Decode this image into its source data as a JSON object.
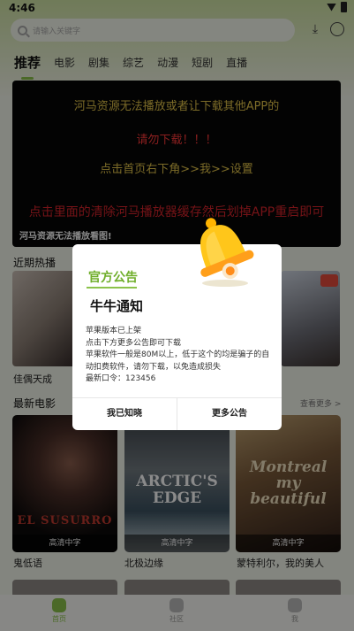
{
  "status": {
    "time": "4:46"
  },
  "search": {
    "placeholder": "请输入关键字"
  },
  "tabs": [
    "推荐",
    "电影",
    "剧集",
    "综艺",
    "动漫",
    "短剧",
    "直播"
  ],
  "banner": {
    "lines": [
      "河马资源无法播放或者让下载其他APP的",
      "请勿下载！！！",
      "点击首页右下角>>我>>设置",
      "点击里面的清除河马播放器缓存然后划掉APP重启即可"
    ],
    "caption": "河马资源无法播放看图!"
  },
  "hot": {
    "title": "近期热播",
    "items": [
      "佳偶天成"
    ]
  },
  "latest": {
    "title": "最新电影",
    "more": "查看更多 >",
    "items": [
      {
        "title": "鬼低语",
        "poster_text": "EL SUSURRO",
        "quality": "高清中字"
      },
      {
        "title": "北极边缘",
        "poster_text": "ARCTIC'S EDGE",
        "quality": "高清中字"
      },
      {
        "title": "蒙特利尔，我的美人",
        "poster_text": "Montreal my beautiful",
        "quality": "高清中字"
      }
    ]
  },
  "bottom_nav": [
    "首页",
    "社区",
    "我"
  ],
  "dialog": {
    "heading": "官方公告",
    "title": "牛牛通知",
    "body": [
      "苹果版本已上架",
      "点击下方更多公告即可下载",
      "苹果软件一般是80M以上，低于这个的均是骗子的自动扣费软件，请勿下载，以免造成损失",
      "最新口令：123456"
    ],
    "ok": "我已知晓",
    "more": "更多公告"
  },
  "colors": {
    "accent": "#8bc34a",
    "banner_yellow": "#e5c64a",
    "banner_red": "#d8242b"
  }
}
